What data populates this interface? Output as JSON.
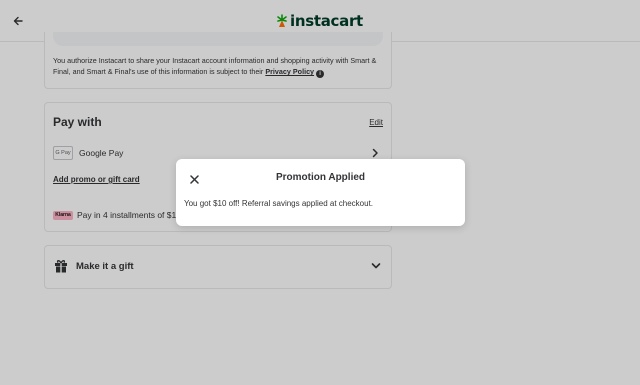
{
  "header": {
    "logo_text": "instacart",
    "back_icon": "arrow-left-icon",
    "brand_color": "#003d29",
    "carrot_colors": [
      "#ff7009",
      "#0aad0a"
    ]
  },
  "consent": {
    "text": "You authorize Instacart to share your Instacart account information and shopping activity with Smart & Final, and Smart & Final's use of this information is subject to their ",
    "link_label": "Privacy Policy",
    "info_icon_glyph": "i"
  },
  "pay": {
    "title": "Pay with",
    "edit_label": "Edit",
    "method_badge": "G Pay",
    "method_label": "Google Pay",
    "promo_label": "Add promo or gift card",
    "klarna_badge": "Klarna",
    "klarna_text": "Pay in 4 installments of $11.1"
  },
  "gift": {
    "label": "Make it a gift",
    "icon": "gift-icon"
  },
  "modal": {
    "title": "Promotion Applied",
    "body": "You got $10 off! Referral savings applied at checkout.",
    "close_icon": "close-icon"
  }
}
